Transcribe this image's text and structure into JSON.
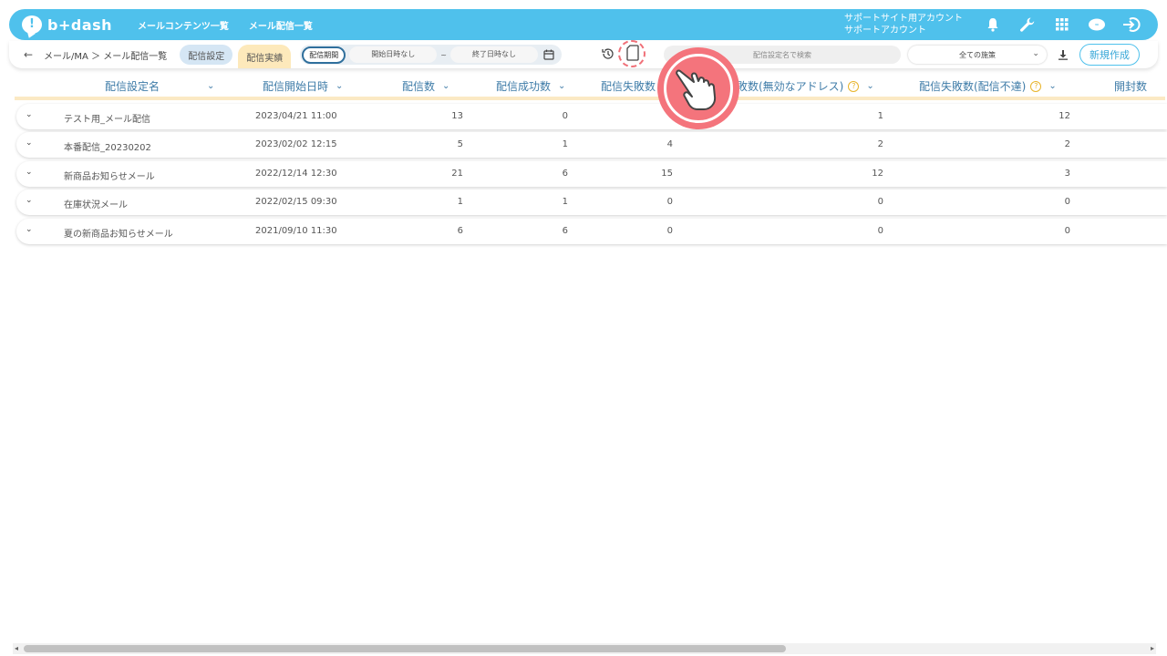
{
  "header": {
    "logo_text": "b+dash",
    "nav": [
      "メールコンテンツ一覧",
      "メール配信一覧"
    ],
    "account_line1": "サポートサイト用アカウント",
    "account_line2": "サポートアカウント",
    "icons": [
      "bell-icon",
      "wrench-icon",
      "grid-icon",
      "cloud-icon",
      "logout-icon"
    ]
  },
  "toolbar": {
    "breadcrumb": "メール/MA ＞ メール配信一覧",
    "tab_settings": "配信設定",
    "tab_results": "配信実績",
    "period_label": "配信期間",
    "start_placeholder": "開始日時なし",
    "tilde": "~",
    "end_placeholder": "終了日時なし",
    "search_placeholder": "配信設定名で検索",
    "filter_selected": "全ての施策",
    "new_button": "新規作成"
  },
  "table": {
    "columns": [
      "配信設定名",
      "配信開始日時",
      "配信数",
      "配信成功数",
      "配信失敗数",
      "敗数(無効なアドレス)",
      "配信失敗数(配信不達)",
      "開封数"
    ],
    "rows": [
      {
        "name": "テスト用_メール配信",
        "date": "2023/04/21 11:00",
        "sent": "13",
        "success": "0",
        "fail": "",
        "invalid": "1",
        "undelivered": "12"
      },
      {
        "name": "本番配信_20230202",
        "date": "2023/02/02 12:15",
        "sent": "5",
        "success": "1",
        "fail": "4",
        "invalid": "2",
        "undelivered": "2"
      },
      {
        "name": "新商品お知らせメール",
        "date": "2022/12/14 12:30",
        "sent": "21",
        "success": "6",
        "fail": "15",
        "invalid": "12",
        "undelivered": "3"
      },
      {
        "name": "在庫状況メール",
        "date": "2022/02/15 09:30",
        "sent": "1",
        "success": "1",
        "fail": "0",
        "invalid": "0",
        "undelivered": "0"
      },
      {
        "name": "夏の新商品お知らせメール",
        "date": "2021/09/10 11:30",
        "sent": "6",
        "success": "6",
        "fail": "0",
        "invalid": "0",
        "undelivered": "0"
      }
    ]
  },
  "colors": {
    "accent": "#4fc1ec",
    "header_text": "#3f7ca8",
    "tab_results_bg": "#fde9bb",
    "tap_hint": "#f4747c"
  }
}
